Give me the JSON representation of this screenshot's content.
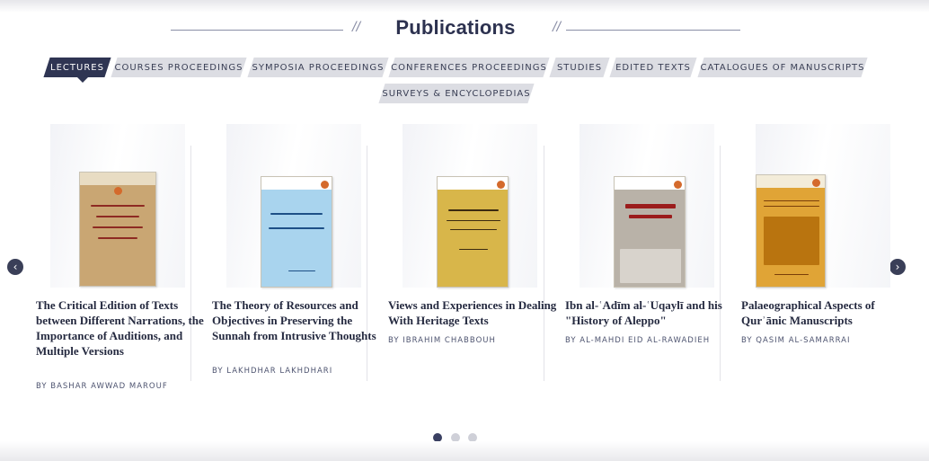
{
  "page_title": "Publications",
  "title_slash": "//",
  "tabs": [
    {
      "label": "LECTURES",
      "active": true
    },
    {
      "label": "COURSES PROCEEDINGS",
      "active": false
    },
    {
      "label": "SYMPOSIA PROCEEDINGS",
      "active": false
    },
    {
      "label": "CONFERENCES PROCEEDINGS",
      "active": false
    },
    {
      "label": "STUDIES",
      "active": false
    },
    {
      "label": "EDITED TEXTS",
      "active": false
    },
    {
      "label": "CATALOGUES OF MANUSCRIPTS",
      "active": false
    },
    {
      "label": "SURVEYS & ENCYCLOPEDIAS",
      "active": false
    }
  ],
  "cards": [
    {
      "title": "The Critical Edition of Texts between Different Narrations, the Importance of Auditions, and Multiple Versions",
      "author": "BY BASHAR AWWAD MAROUF",
      "cover_color": "#c9a673",
      "cover_accent": "#8e2a22"
    },
    {
      "title": "The Theory of Resources and Objectives in Preserving the Sunnah from Intrusive Thoughts",
      "author": "BY LAKHDHAR LAKHDHARI",
      "cover_color": "#a9d4ee",
      "cover_accent": "#1d4f86"
    },
    {
      "title": "Views and Experiences in Dealing With Heritage Texts",
      "author": "BY IBRAHIM CHABBOUH",
      "cover_color": "#d8b64a",
      "cover_accent": "#3b2a10"
    },
    {
      "title": "Ibn al-ʿAdīm al-ʿUqaylī and his \"History of Aleppo\"",
      "author": "BY AL-MAHDI EID AL-RAWADIEH",
      "cover_color": "#b9b2a8",
      "cover_accent": "#9b1c1c"
    },
    {
      "title": "Palaeographical Aspects of Qurʾānic Manuscripts",
      "author": "BY QASIM AL-SAMARRAI",
      "cover_color": "#e0a436",
      "cover_accent": "#7a3e09"
    }
  ],
  "nav": {
    "prev_icon": "‹",
    "next_icon": "›"
  },
  "pagination": {
    "pages": 3,
    "current": 1
  }
}
